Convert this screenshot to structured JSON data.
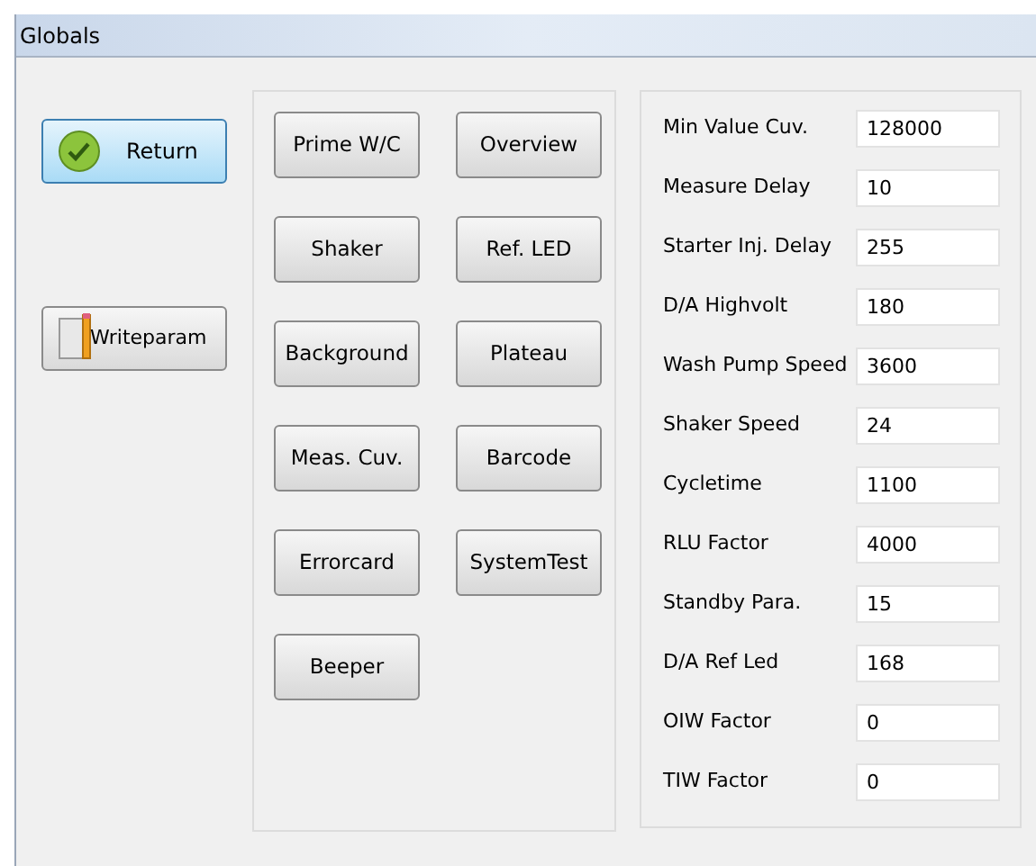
{
  "window": {
    "title": "Globals"
  },
  "side_buttons": [
    {
      "label": "Return",
      "kind": "confirm",
      "focused": true
    },
    {
      "label": "Writeparam",
      "kind": "write",
      "focused": false
    }
  ],
  "function_buttons": [
    "Prime W/C",
    "Overview",
    "Shaker",
    "Ref. LED",
    "Background",
    "Plateau",
    "Meas. Cuv.",
    "Barcode",
    "Errorcard",
    "SystemTest",
    "Beeper"
  ],
  "parameters": [
    {
      "label": "Min Value Cuv.",
      "value": "128000"
    },
    {
      "label": "Measure Delay",
      "value": "10"
    },
    {
      "label": "Starter Inj. Delay",
      "value": "255"
    },
    {
      "label": "D/A Highvolt",
      "value": "180"
    },
    {
      "label": "Wash Pump Speed",
      "value": "3600"
    },
    {
      "label": "Shaker Speed",
      "value": "24"
    },
    {
      "label": "Cycletime",
      "value": "1100"
    },
    {
      "label": "RLU Factor",
      "value": "4000"
    },
    {
      "label": "Standby Para.",
      "value": "15"
    },
    {
      "label": "D/A Ref Led",
      "value": "168"
    },
    {
      "label": "OIW Factor",
      "value": "0"
    },
    {
      "label": "TIW Factor",
      "value": "0"
    }
  ]
}
